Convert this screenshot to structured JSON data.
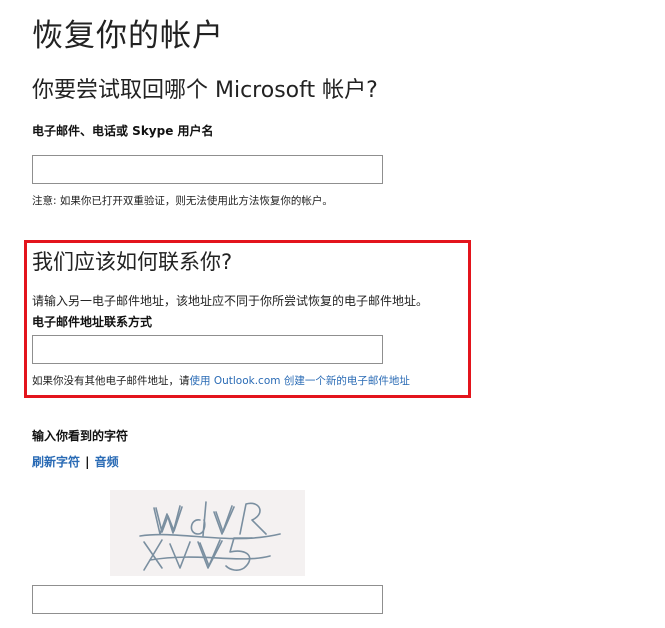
{
  "page": {
    "title": "恢复你的帐户",
    "subtitle": "你要尝试取回哪个 Microsoft 帐户?"
  },
  "account": {
    "label": "电子邮件、电话或 Skype 用户名",
    "value": "",
    "note": "注意: 如果你已打开双重验证，则无法使用此方法恢复你的帐户。"
  },
  "contact": {
    "title": "我们应该如何联系你?",
    "description": "请输入另一电子邮件地址，该地址应不同于你所尝试恢复的电子邮件地址。",
    "label": "电子邮件地址联系方式",
    "value": "",
    "hint_prefix": "如果你没有其他电子邮件地址，请",
    "hint_link": "使用 Outlook.com 创建一个新的电子邮件地址"
  },
  "captcha": {
    "label": "输入你看到的字符",
    "refresh_link": "刷新字符",
    "separator": "|",
    "audio_link": "音频",
    "value": "",
    "image_text": "WdVR XVV5"
  },
  "colors": {
    "highlight": "#e3141c",
    "link": "#2a6bb5"
  }
}
